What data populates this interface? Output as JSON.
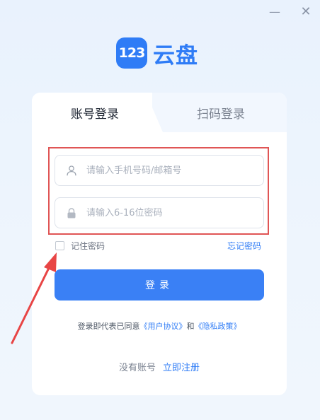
{
  "window": {
    "minimize_glyph": "—",
    "close_glyph": "✕"
  },
  "brand": {
    "logo_text": "123",
    "name": "云盘",
    "accent_color": "#2f7cf6"
  },
  "tabs": [
    {
      "label": "账号登录",
      "active": true
    },
    {
      "label": "扫码登录",
      "active": false
    }
  ],
  "form": {
    "account": {
      "placeholder": "请输入手机号码/邮箱号",
      "value": "",
      "icon": "user-icon"
    },
    "password": {
      "placeholder": "请输入6-16位密码",
      "value": "",
      "icon": "lock-icon"
    },
    "remember_label": "记住密码",
    "remember_checked": false,
    "forgot_label": "忘记密码",
    "login_label": "登录"
  },
  "agreement": {
    "prefix": "登录即代表已同意",
    "terms": "《用户协议》",
    "conjunction": "和",
    "privacy": "《隐私政策》"
  },
  "register": {
    "prompt": "没有账号",
    "link": "立即注册"
  },
  "annotations": {
    "highlight_color": "#e05555"
  }
}
